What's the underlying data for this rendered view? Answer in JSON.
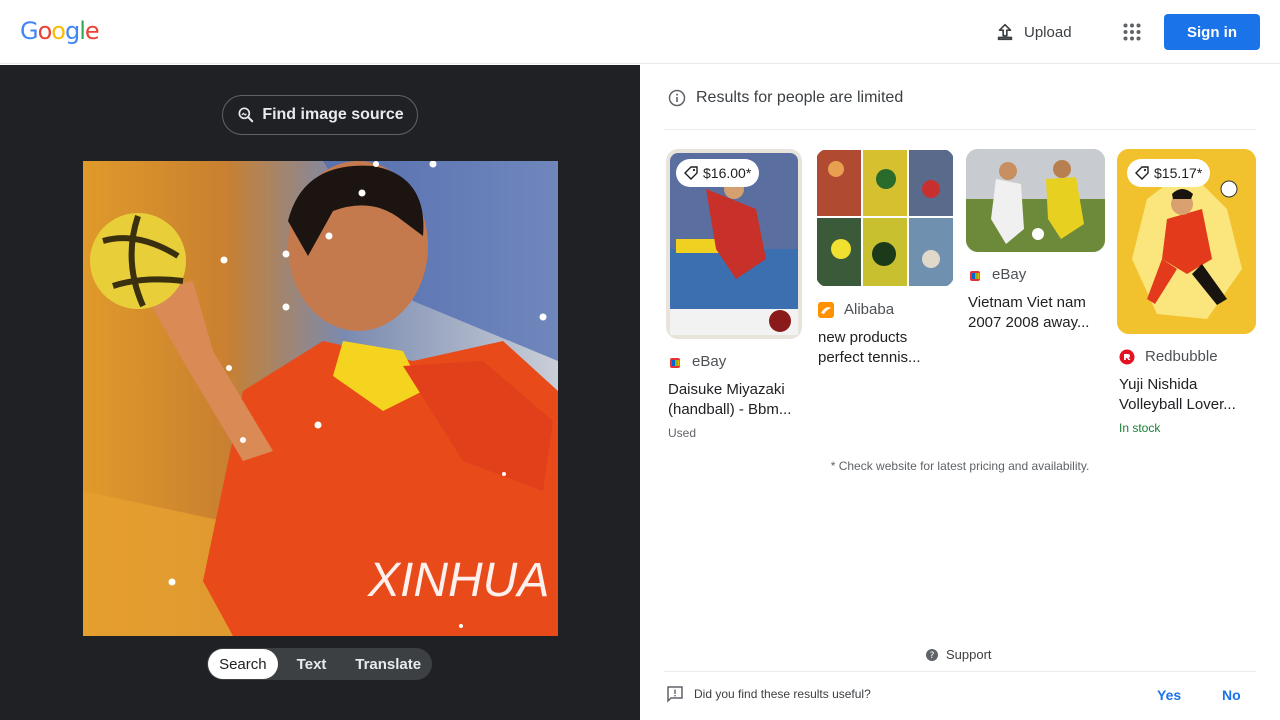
{
  "header": {
    "logo": [
      "G",
      "o",
      "o",
      "g",
      "l",
      "e"
    ],
    "logo_colors": [
      "#4285f4",
      "#ea4335",
      "#fbbc05",
      "#4285f4",
      "#34a853",
      "#ea4335"
    ],
    "upload_label": "Upload",
    "signin_label": "Sign in"
  },
  "left_panel": {
    "find_source_label": "Find image source",
    "photo_caption": "XINHUA",
    "modes": [
      "Search",
      "Text",
      "Translate"
    ],
    "active_mode": "Search"
  },
  "results": {
    "notice": "Results for people are limited",
    "items": [
      {
        "price": "$16.00*",
        "source": "eBay",
        "title_line1": "Daisuke Miyazaki",
        "title_line2": "(handball) - Bbm...",
        "sub": "Used"
      },
      {
        "price": "",
        "source": "Alibaba",
        "title_line1": "new products",
        "title_line2": "perfect tennis...",
        "sub": ""
      },
      {
        "price": "",
        "source": "eBay",
        "title_line1": "Vietnam Viet nam",
        "title_line2": "2007 2008 away...",
        "sub": ""
      },
      {
        "price": "$15.17*",
        "source": "Redbubble",
        "title_line1": "Yuji Nishida",
        "title_line2": "Volleyball Lover...",
        "sub": "In stock"
      }
    ],
    "disclaimer": "* Check website for latest pricing and availability.",
    "support_label": "Support",
    "feedback_question": "Did you find these results useful?",
    "yes_label": "Yes",
    "no_label": "No"
  },
  "colors": {
    "accent": "#1a73e8",
    "dark_panel": "#202124",
    "in_stock": "#188038",
    "used": "#5f6368"
  }
}
